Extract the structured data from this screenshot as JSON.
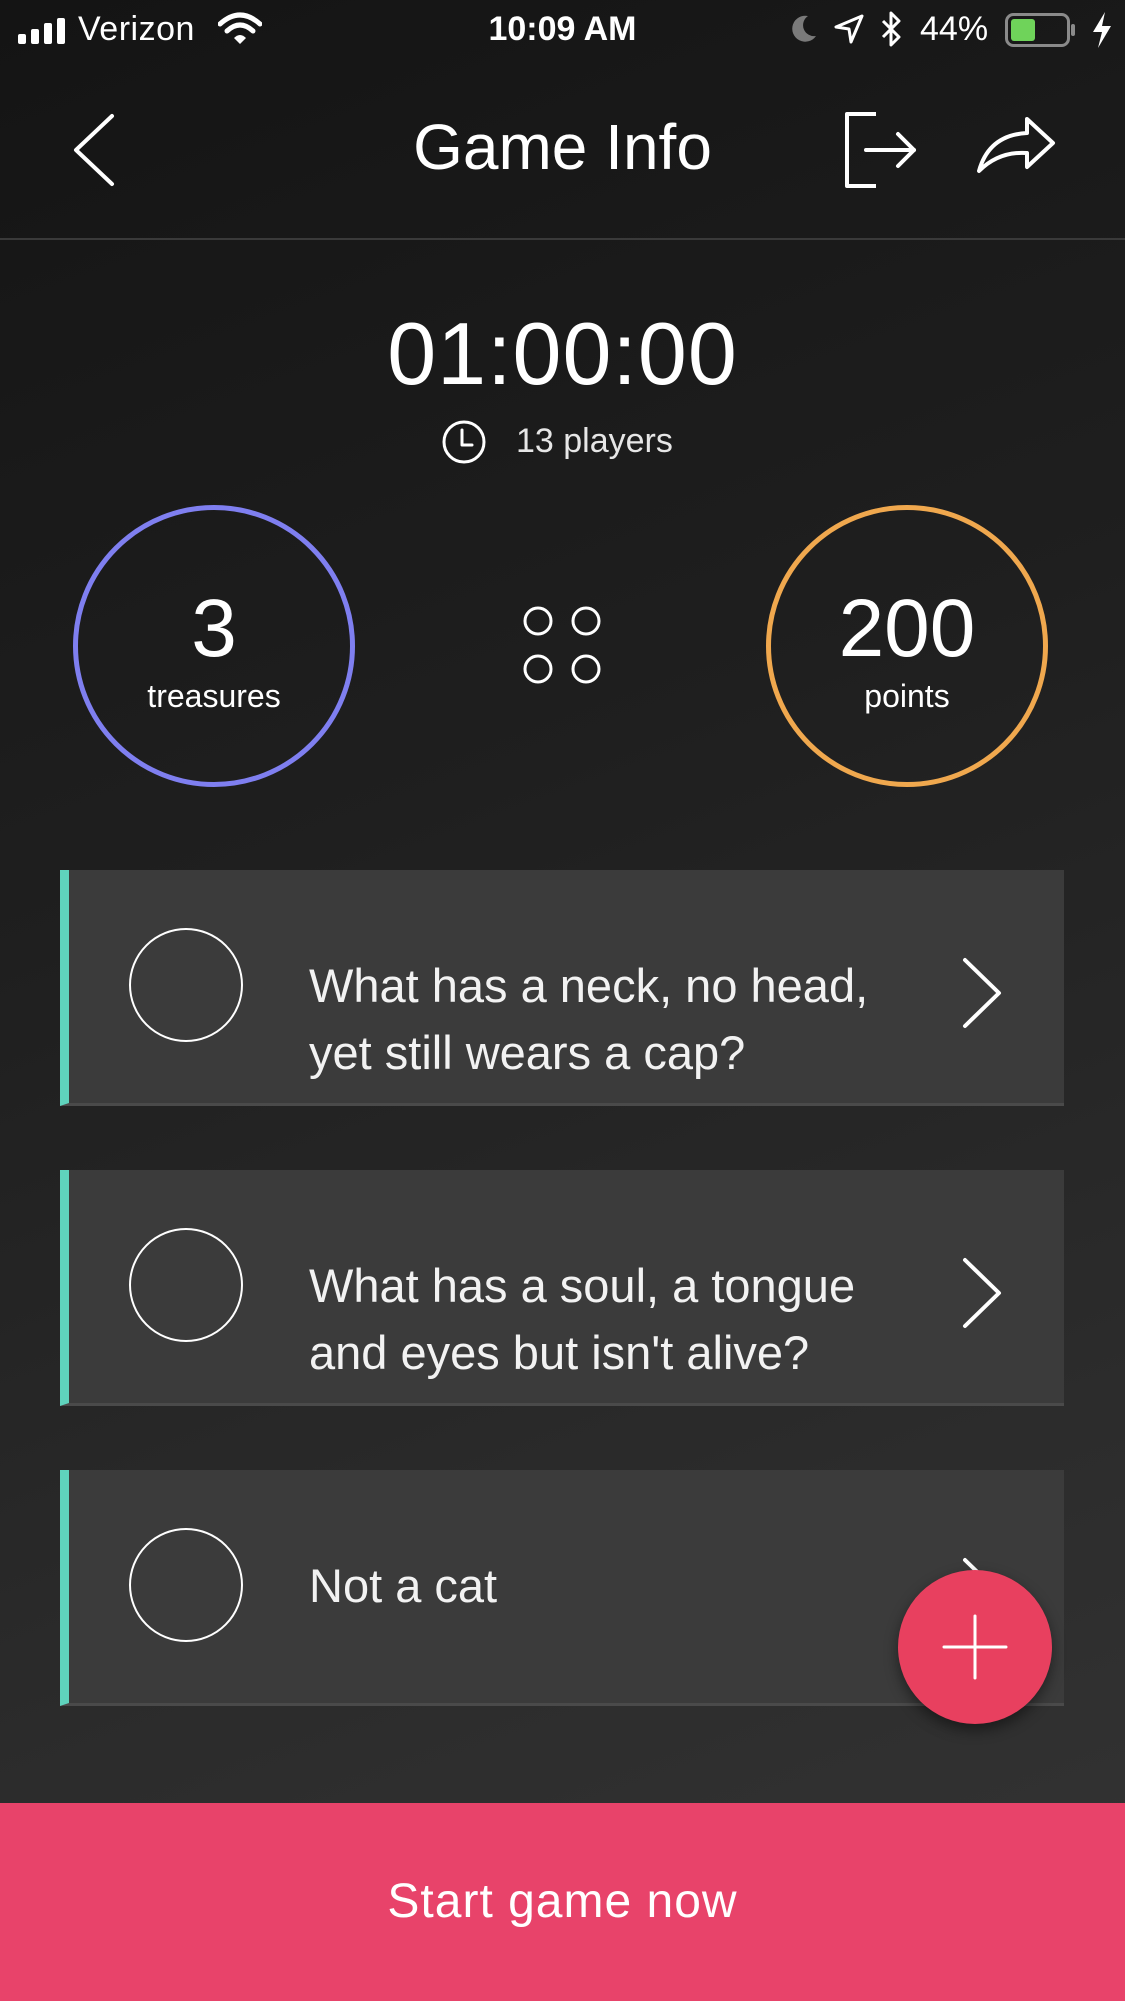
{
  "status_bar": {
    "carrier": "Verizon",
    "time": "10:09 AM",
    "battery_percent": "44%",
    "battery_level": 0.44,
    "battery_color": "#6fd35a"
  },
  "nav": {
    "title": "Game Info",
    "back_icon": "chevron-left-icon",
    "exit_icon": "exit-icon",
    "share_icon": "share-arrow-icon"
  },
  "game": {
    "timer": "01:00:00",
    "players": "13 players",
    "treasures": {
      "value": "3",
      "label": "treasures",
      "color": "#7f7ff0"
    },
    "points": {
      "value": "200",
      "label": "points",
      "color": "#f0a84e"
    }
  },
  "riddles": [
    {
      "text_line1": "What has a neck, no head,",
      "text_line2": "yet still wears a cap?"
    },
    {
      "text_line1": "What has a soul, a tongue",
      "text_line2": "and eyes but isn't alive?"
    },
    {
      "text": "Not a cat"
    }
  ],
  "accent_color": "#5fd3bd",
  "start_button": {
    "label": "Start game now",
    "color": "#e8436a"
  },
  "fab_icon": "plus-icon"
}
